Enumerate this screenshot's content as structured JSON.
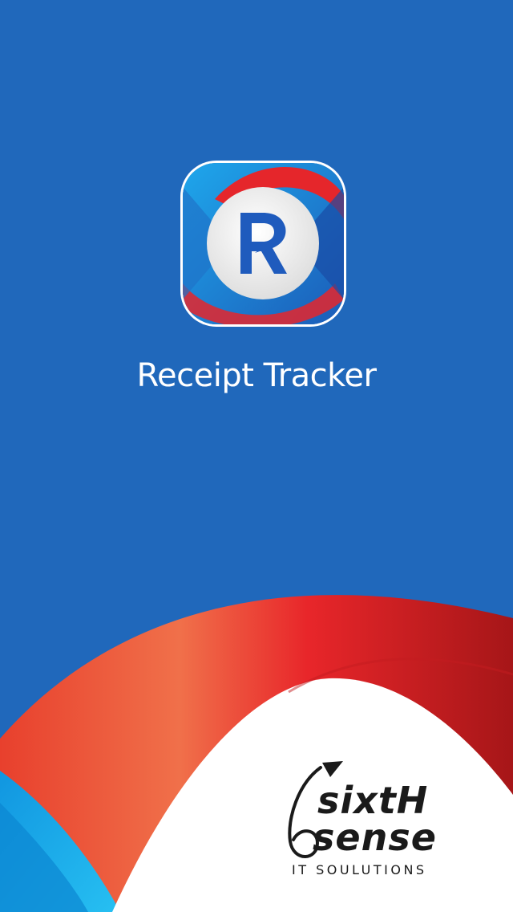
{
  "app": {
    "title": "Receipt Tracker",
    "icon": "receipt-tracker-r-icon",
    "icon_letter": "R"
  },
  "company_logo": {
    "line1": "sixtH",
    "line2": "sense",
    "tagline": "IT SOULUTIONS",
    "mark": "arrow-swirl-6-icon"
  },
  "colors": {
    "background": "#2068bb",
    "accent_red": "#e5262b",
    "accent_cyan": "#1ab0ec",
    "white": "#ffffff"
  }
}
